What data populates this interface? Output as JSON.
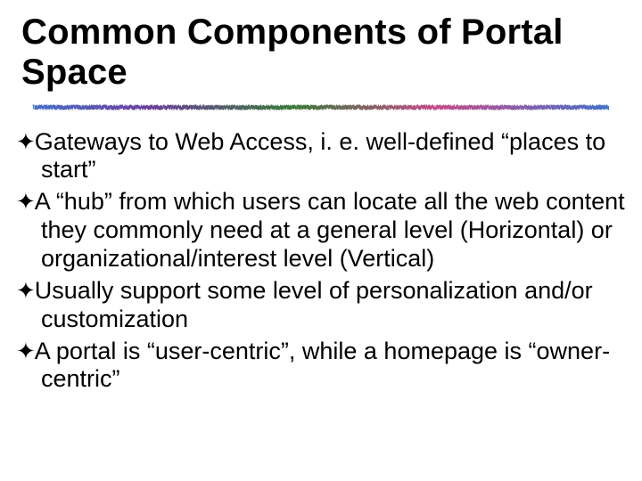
{
  "slide": {
    "title": "Common Components of Portal Space",
    "bullets": [
      "Gateways to Web Access, i. e. well-defined “places to start”",
      "A “hub” from which users can locate all the web content they commonly need at a general level (Horizontal) or organizational/interest level (Vertical)",
      "Usually support some level of personalization and/or customization",
      "A portal is “user-centric”, while a homepage is “owner-centric”"
    ],
    "bullet_glyph": "✦"
  }
}
